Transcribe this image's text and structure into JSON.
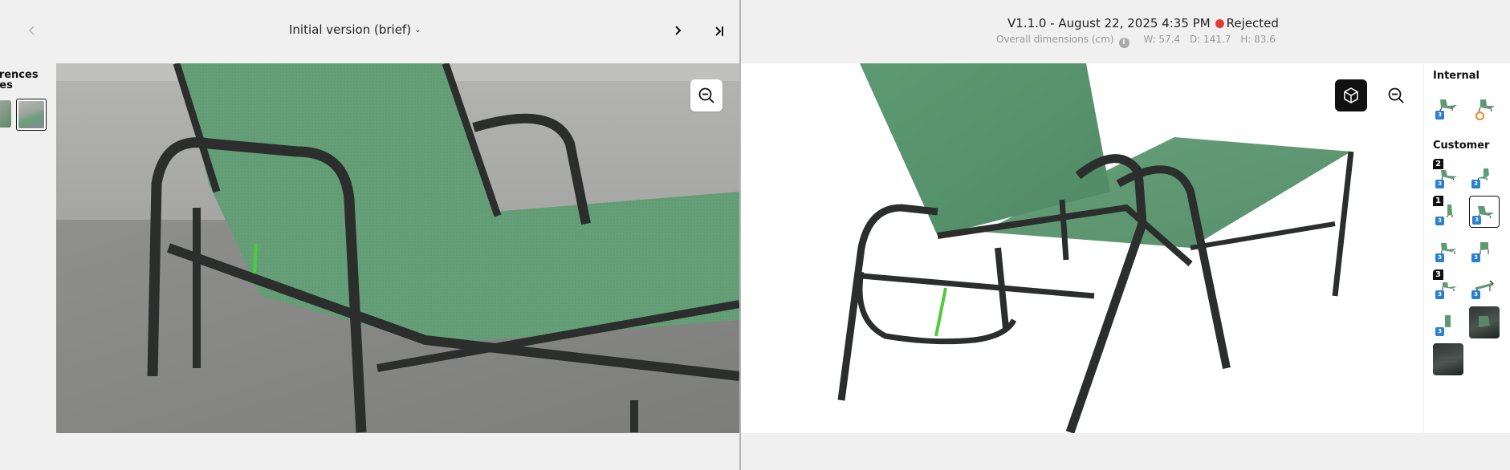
{
  "left_header": {
    "prev_icon": "chevron-left-icon",
    "version_label": "Initial version (brief)",
    "dropdown_icon": "chevron-down-icon",
    "next_icon": "chevron-right-icon",
    "last_icon": "skip-to-end-icon"
  },
  "references": {
    "label_line1": "erences",
    "label_line2": "ges"
  },
  "right_header": {
    "version_title": "V1.1.0 - August 22, 2025 4:35 PM",
    "status": "Rejected",
    "status_color": "#e53935",
    "dims_label": "Overall dimensions (cm)",
    "width": "W: 57.4",
    "depth": "D: 141.7",
    "height": "H: 83.6"
  },
  "side_panel": {
    "internal_label": "Internal",
    "customer_label": "Customer",
    "badges": {
      "b2": "2",
      "b1": "1",
      "b3": "3",
      "three_d": "3"
    }
  },
  "colors": {
    "chair_green": "#5d9a72",
    "frame_dark": "#2b2e2d",
    "highlight_line": "#4ccd3a",
    "accent_dark": "#111111"
  }
}
